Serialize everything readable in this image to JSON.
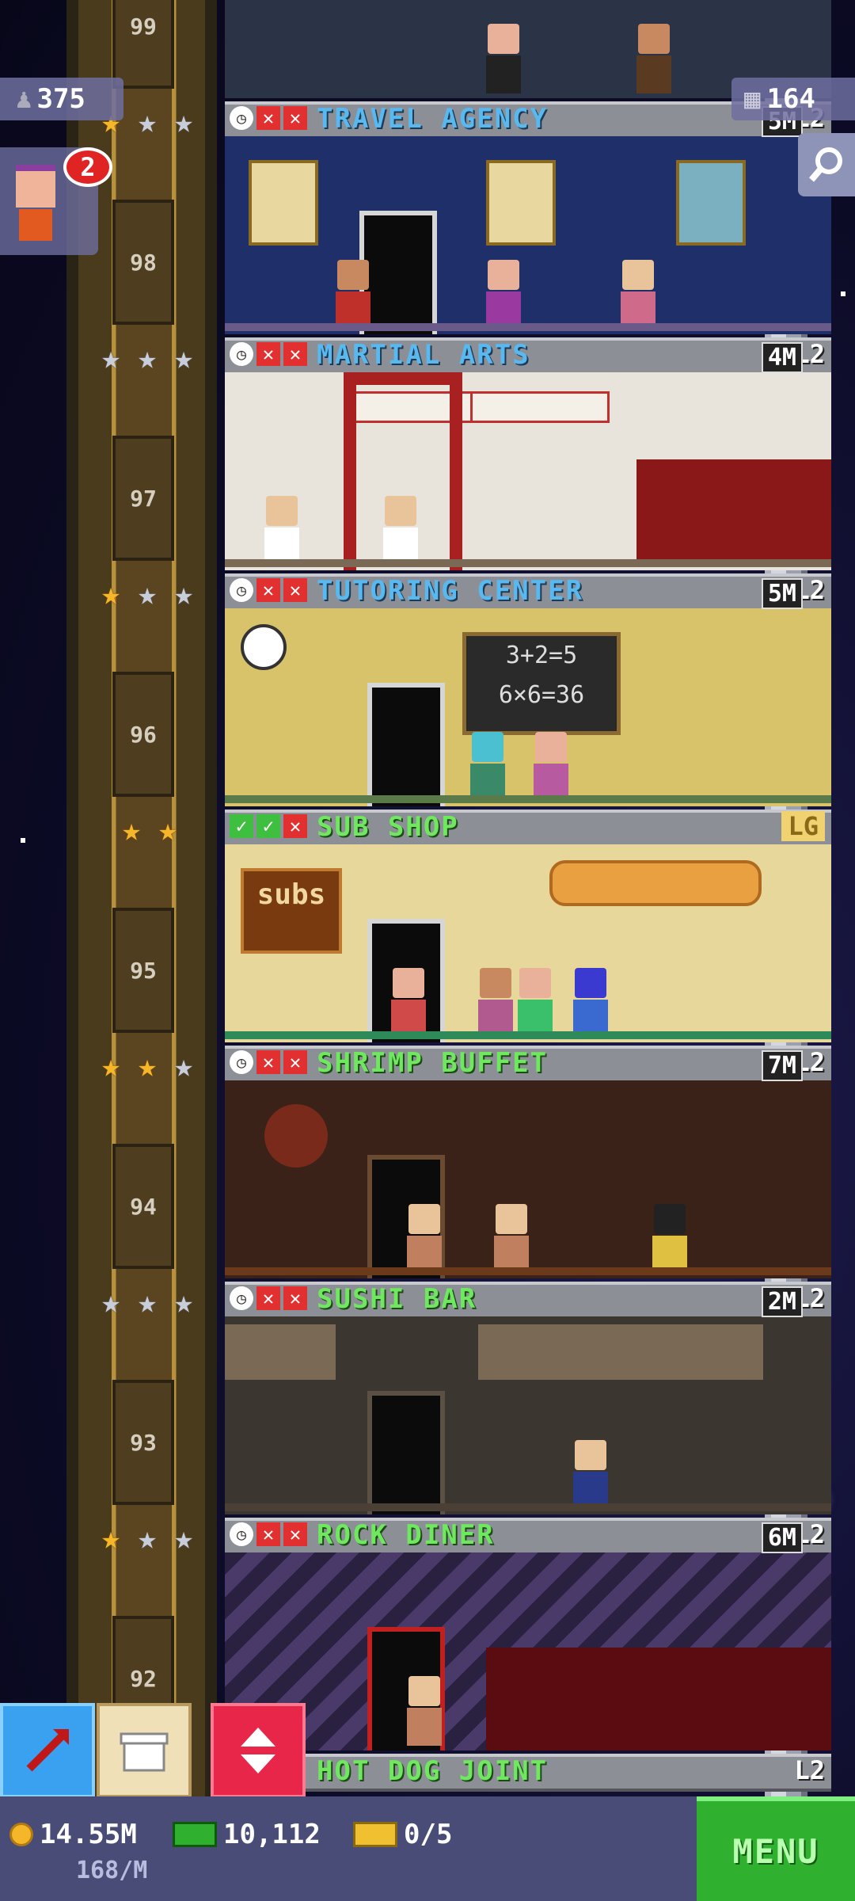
{
  "hud": {
    "population": "375",
    "floors": "164",
    "vip_count": "2",
    "coins": "14.55M",
    "income": "168/M",
    "bux": "10,112",
    "tickets": "0/5",
    "menu_label": "MENU"
  },
  "floors": [
    {
      "number": "99",
      "name": "",
      "level": "",
      "time": ""
    },
    {
      "number": "98",
      "name": "TRAVEL AGENCY",
      "level": "L2",
      "time": "5M",
      "stars": [
        "gold",
        "silver",
        "silver"
      ],
      "status": [
        "clock",
        "x",
        "x"
      ],
      "color": "blue"
    },
    {
      "number": "97",
      "name": "MARTIAL ARTS",
      "level": "L2",
      "time": "4M",
      "stars": [
        "silver",
        "silver",
        "silver"
      ],
      "status": [
        "clock",
        "x",
        "x"
      ],
      "color": "blue"
    },
    {
      "number": "96",
      "name": "TUTORING CENTER",
      "level": "L2",
      "time": "5M",
      "stars": [
        "gold",
        "silver",
        "silver"
      ],
      "status": [
        "clock",
        "x",
        "x"
      ],
      "color": "blue"
    },
    {
      "number": "95",
      "name": "SUB SHOP",
      "level": "LG",
      "time": "",
      "stars": [
        "gold",
        "gold"
      ],
      "status": [
        "ok",
        "ok",
        "x"
      ],
      "color": "green"
    },
    {
      "number": "94",
      "name": "SHRIMP BUFFET",
      "level": "L2",
      "time": "7M",
      "stars": [
        "gold",
        "gold",
        "silver"
      ],
      "status": [
        "clock",
        "x",
        "x"
      ],
      "color": "green"
    },
    {
      "number": "93",
      "name": "SUSHI BAR",
      "level": "L2",
      "time": "2M",
      "stars": [
        "silver",
        "silver",
        "silver"
      ],
      "status": [
        "clock",
        "x",
        "x"
      ],
      "color": "green"
    },
    {
      "number": "92",
      "name": "ROCK DINER",
      "level": "L2",
      "time": "6M",
      "stars": [
        "gold",
        "silver",
        "silver"
      ],
      "status": [
        "clock",
        "x",
        "x"
      ],
      "color": "green"
    },
    {
      "number": "",
      "name": "HOT DOG JOINT",
      "level": "L2",
      "time": "",
      "stars": [],
      "status": [],
      "color": "green"
    }
  ],
  "room_text": {
    "sub_sign": "subs",
    "chalkboard_line1": "3+2=5",
    "chalkboard_line2": "6×6=36"
  }
}
